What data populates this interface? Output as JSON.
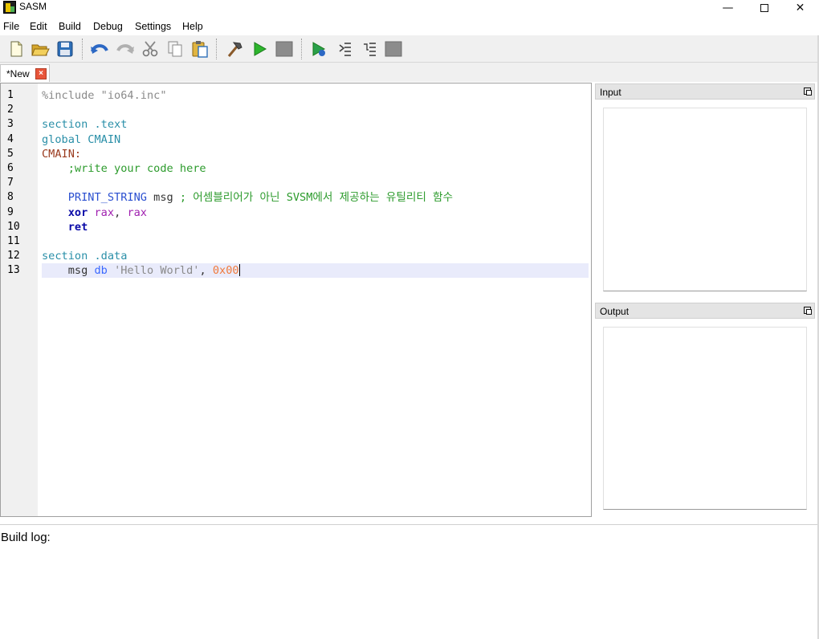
{
  "window": {
    "title": "SASM"
  },
  "menu": [
    "File",
    "Edit",
    "Build",
    "Debug",
    "Settings",
    "Help"
  ],
  "tab": {
    "label": "*New"
  },
  "editor": {
    "line_numbers": [
      "1",
      "2",
      "3",
      "4",
      "5",
      "6",
      "7",
      "8",
      "9",
      "10",
      "11",
      "12",
      "13"
    ],
    "lines": [
      "%include \"io64.inc\"",
      "",
      "section .text",
      "global CMAIN",
      "CMAIN:",
      "    ;write your code here",
      "",
      "    PRINT_STRING msg ; 어셈블리어가 아닌 SVSM에서 제공하는 유틸리티 함수",
      "    xor rax, rax",
      "    ret",
      "",
      "section .data",
      "    msg db 'Hello World', 0x00"
    ]
  },
  "panels": {
    "input_title": "Input",
    "output_title": "Output"
  },
  "build_log": {
    "label": "Build log:"
  },
  "colors": {
    "current_line": "#e9ebfb",
    "keyword": "#0a0aa8",
    "register": "#a020b0",
    "comment": "#2c9b2c",
    "section": "#2a8fa8",
    "label": "#9a3a1e",
    "number": "#f07a3c"
  }
}
